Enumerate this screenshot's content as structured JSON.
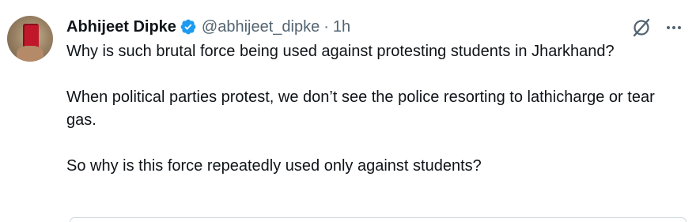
{
  "author": {
    "display_name": "Abhijeet Dipke",
    "handle": "@abhijeet_dipke",
    "separator": "·",
    "time": "1h",
    "verified": true
  },
  "tweet": {
    "paragraphs": [
      "Why is such brutal force being used against protesting students in Jharkhand?",
      "When political parties protest, we don’t see the police resorting to lathicharge or tear gas.",
      "So why is this force repeatedly used only against students?"
    ]
  },
  "icons": {
    "verified": "verified-badge-icon",
    "grok": "grok-icon",
    "more": "more-options-icon"
  },
  "colors": {
    "verified_blue": "#1d9bf0",
    "text_primary": "#0f1419",
    "text_secondary": "#536471"
  }
}
